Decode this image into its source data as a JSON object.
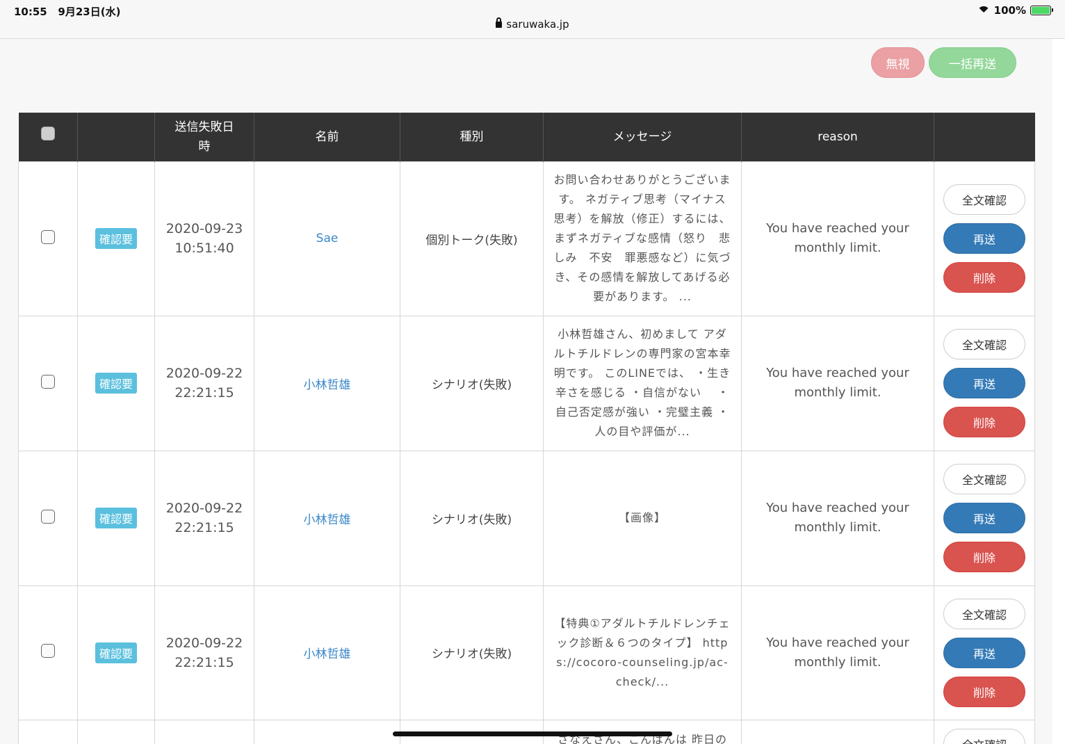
{
  "status_bar": {
    "time": "10:55",
    "date": "9月23日(水)",
    "url": "saruwaka.jp",
    "battery": "100%"
  },
  "toolbar": {
    "ignore_label": "無視",
    "bulk_resend_label": "一括再送"
  },
  "table": {
    "headers": {
      "checkbox": "",
      "status": "",
      "failed_at": "送信失敗日時",
      "name": "名前",
      "type": "種別",
      "message": "メッセージ",
      "reason": "reason",
      "actions": ""
    },
    "rows": [
      {
        "badge": "確認要",
        "date": "2020-09-23",
        "time": "10:51:40",
        "name": "Sae",
        "type": "個別トーク(失敗)",
        "message": "お問い合わせありがとうございます。 ネガティブ思考（マイナス思考）を解放（修正）するには、まずネガティブな感情（怒り　悲しみ　不安　罪悪感など）に気づき、その感情を解放してあげる必要があります。 ...",
        "reason": "You have reached your monthly limit.",
        "full_label": "全文確認",
        "resend_label": "再送",
        "delete_label": "削除"
      },
      {
        "badge": "確認要",
        "date": "2020-09-22",
        "time": "22:21:15",
        "name": "小林哲雄",
        "type": "シナリオ(失敗)",
        "message": "小林哲雄さん、初めまして アダルトチルドレンの専門家の宮本幸明です。 このLINEでは、 ・生き辛さを感じる ・自信がない　 ・自己否定感が強い ・完璧主義 ・人の目や評価が...",
        "reason": "You have reached your monthly limit.",
        "full_label": "全文確認",
        "resend_label": "再送",
        "delete_label": "削除"
      },
      {
        "badge": "確認要",
        "date": "2020-09-22",
        "time": "22:21:15",
        "name": "小林哲雄",
        "type": "シナリオ(失敗)",
        "message": "【画像】",
        "reason": "You have reached your monthly limit.",
        "full_label": "全文確認",
        "resend_label": "再送",
        "delete_label": "削除"
      },
      {
        "badge": "確認要",
        "date": "2020-09-22",
        "time": "22:21:15",
        "name": "小林哲雄",
        "type": "シナリオ(失敗)",
        "message": "【特典①アダルトチルドレンチェック診断＆６つのタイプ】 https://cocoro-counseling.jp/ac-check/...",
        "reason": "You have reached your monthly limit.",
        "full_label": "全文確認",
        "resend_label": "再送",
        "delete_label": "削除"
      },
      {
        "message": "さなえさん、こんばんは 昨日の",
        "full_label": "全文確認"
      }
    ]
  }
}
